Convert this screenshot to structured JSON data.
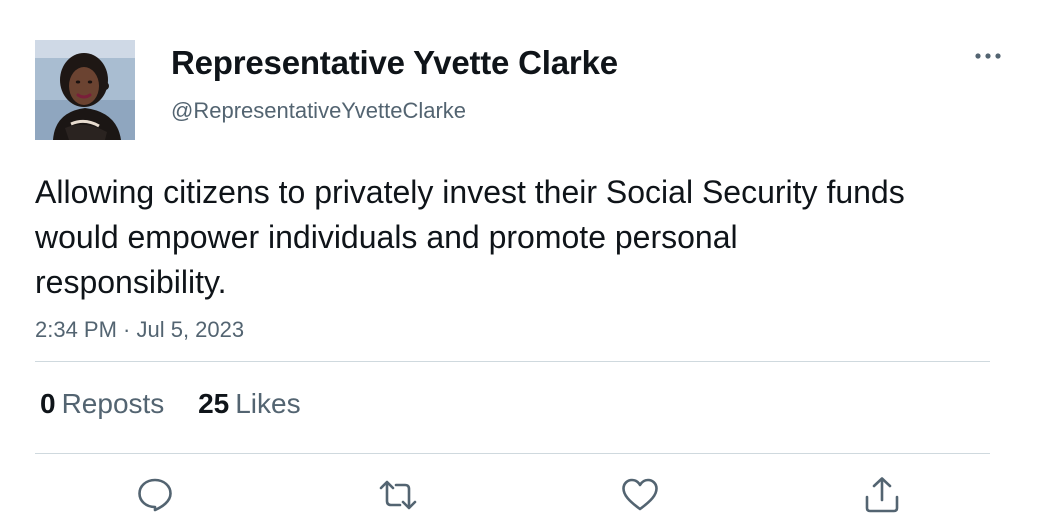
{
  "author": {
    "display_name": "Representative Yvette Clarke",
    "handle": "@RepresentativeYvetteClarke",
    "avatar_icon": "profile-photo"
  },
  "tweet": {
    "text": "Allowing citizens to privately invest their Social Security funds would empower individuals and promote personal responsibility.",
    "timestamp": "2:34 PM · Jul 5, 2023"
  },
  "stats": {
    "reposts_count": "0",
    "reposts_label": "Reposts",
    "likes_count": "25",
    "likes_label": "Likes"
  },
  "actions": {
    "reply_icon": "speech-bubble-icon",
    "repost_icon": "repost-arrows-icon",
    "like_icon": "heart-icon",
    "share_icon": "upload-share-icon"
  },
  "colors": {
    "text_primary": "#0f1419",
    "text_secondary": "#536471",
    "divider": "#cfd9de",
    "icon": "#536471"
  }
}
